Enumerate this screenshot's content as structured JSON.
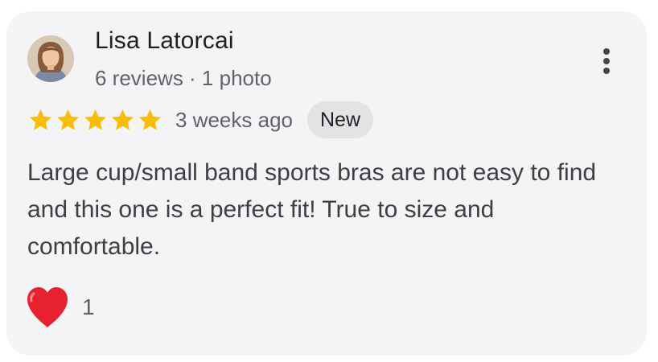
{
  "review": {
    "author": {
      "name": "Lisa Latorcai",
      "meta": "6 reviews · 1 photo",
      "avatar_icon": "profile-photo"
    },
    "rating": 5,
    "star_color": "#fbbc04",
    "time_ago": "3 weeks ago",
    "badge": "New",
    "text": "Large cup/small band sports bras are not easy to find and this one is a perfect fit! True to size and comfortable.",
    "reaction": {
      "icon": "heart-icon",
      "color": "#e8212e",
      "count": "1"
    }
  }
}
